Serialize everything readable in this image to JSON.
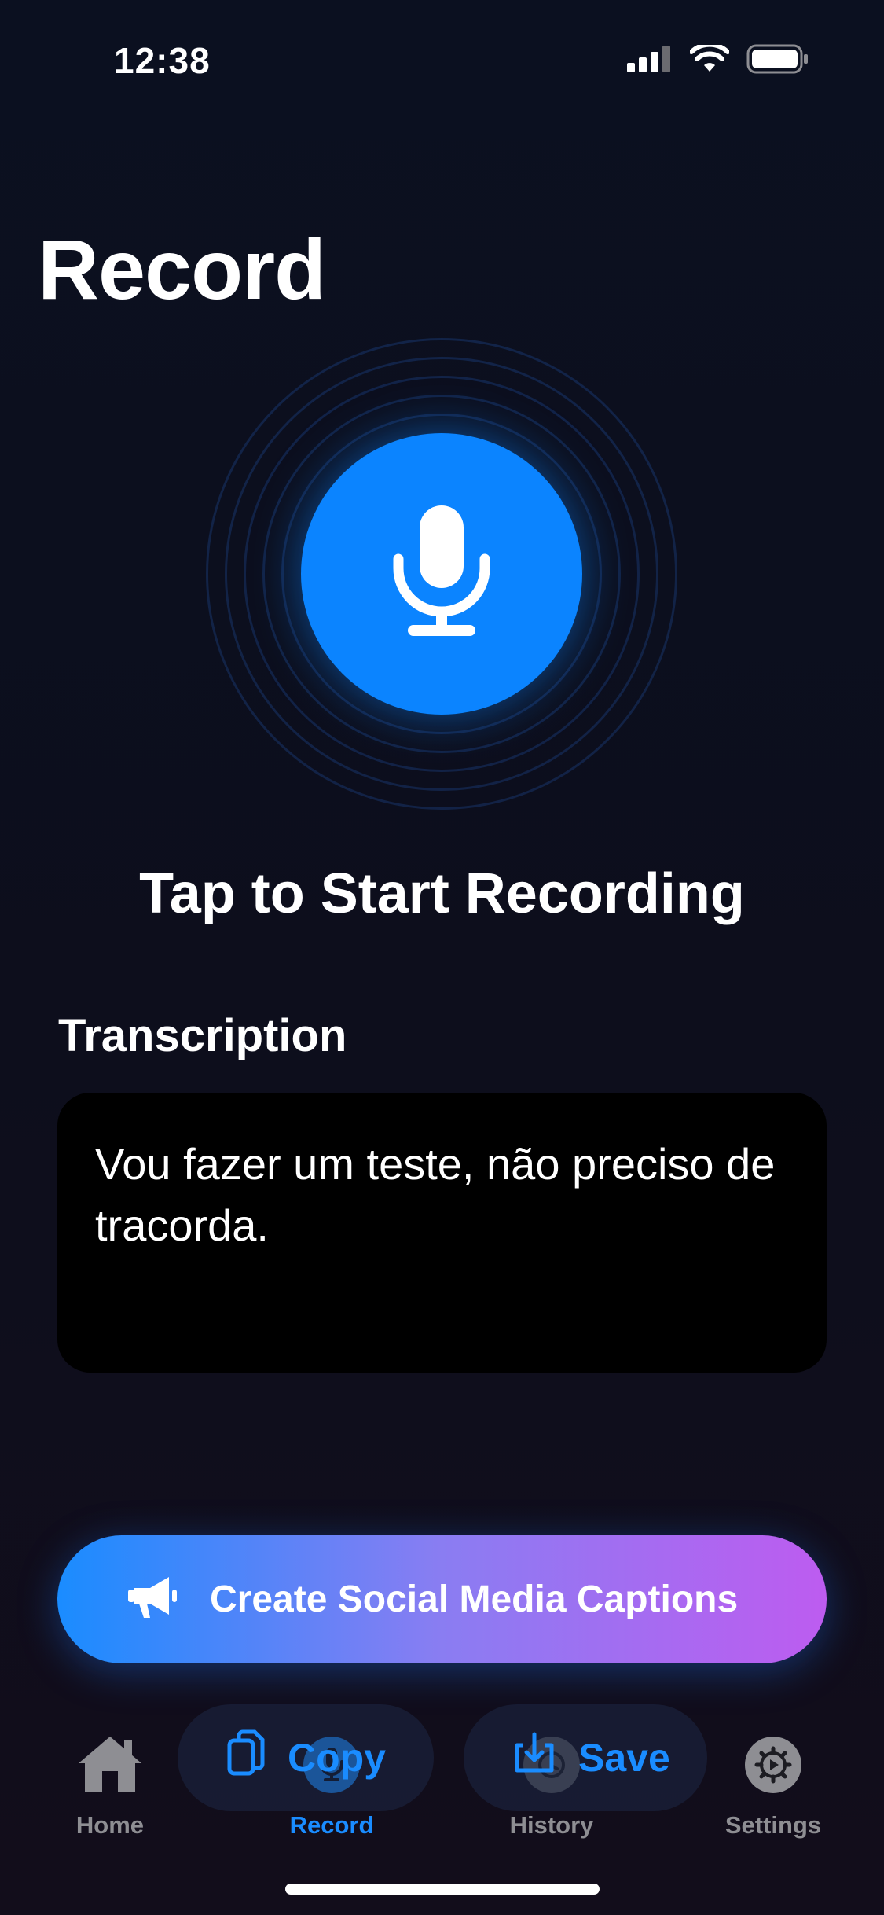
{
  "status_bar": {
    "time": "12:38",
    "icons": [
      "cellular-signal-icon",
      "wifi-icon",
      "battery-icon"
    ]
  },
  "page": {
    "title": "Record"
  },
  "record": {
    "icon": "microphone-icon",
    "prompt": "Tap to Start Recording",
    "accent_color": "#0B84FF"
  },
  "transcription": {
    "label": "Transcription",
    "text": "Vou fazer um teste, não preciso de tracorda."
  },
  "captions_button": {
    "icon": "megaphone-icon",
    "label": "Create Social Media Captions",
    "gradient": [
      "#1A8CFF",
      "#BD5CF0"
    ]
  },
  "actions": {
    "copy_label": "Copy",
    "copy_icon": "copy-icon",
    "save_label": "Save",
    "save_icon": "save-icon"
  },
  "tabs": [
    {
      "label": "Home",
      "icon": "home-icon",
      "active": false
    },
    {
      "label": "Record",
      "icon": "microphone-icon",
      "active": true
    },
    {
      "label": "History",
      "icon": "history-icon",
      "active": false
    },
    {
      "label": "Settings",
      "icon": "gear-icon",
      "active": false
    }
  ],
  "colors": {
    "active_tab": "#1A8CFF",
    "inactive_tab": "#8E8E93"
  }
}
